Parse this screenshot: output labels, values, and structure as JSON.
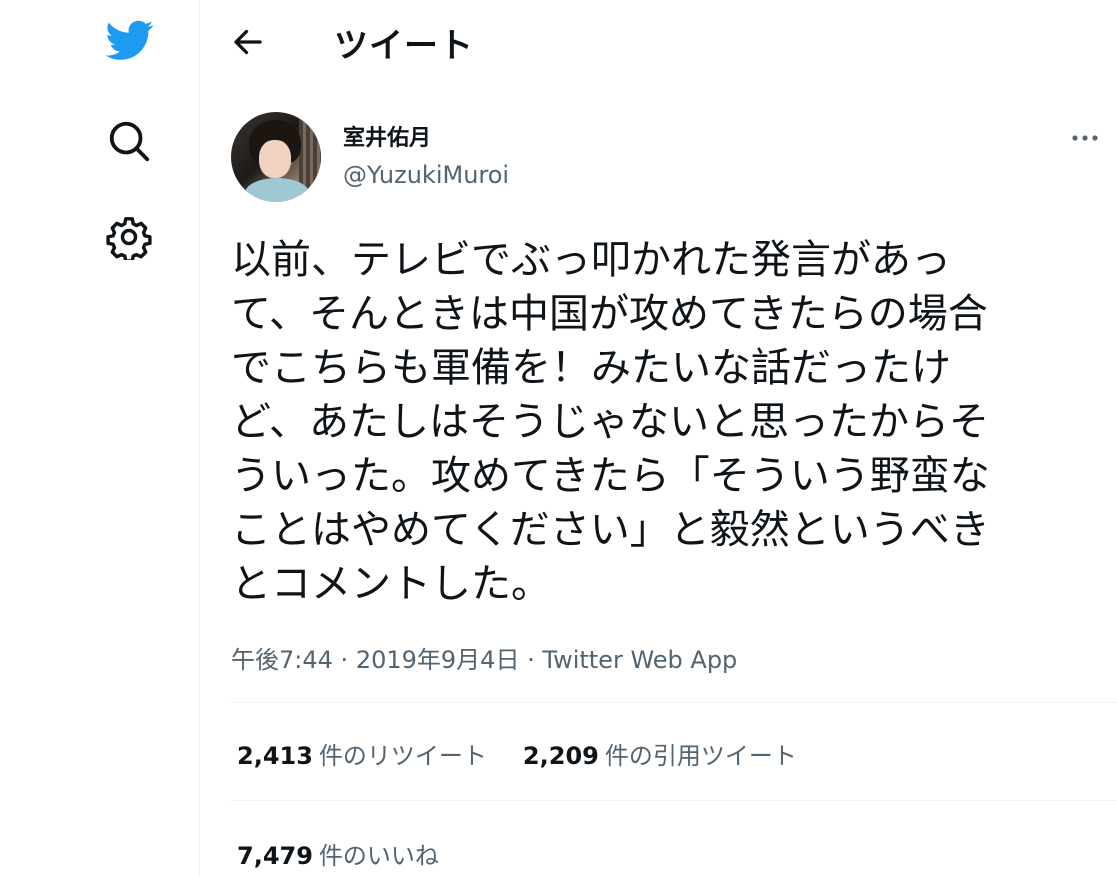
{
  "colors": {
    "accent": "#1d9bf0",
    "text": "#0f1419",
    "secondary": "#536471",
    "border": "#eff3f4"
  },
  "sidebar": {
    "icons": [
      "twitter-logo-icon",
      "search-icon",
      "settings-icon"
    ]
  },
  "header": {
    "title": "ツイート",
    "back_icon": "arrow-left-icon"
  },
  "tweet": {
    "display_name": "室井佑月",
    "handle": "@YuzukiMuroi",
    "lines": [
      "以前、テレビでぶっ叩かれた発言があっ",
      "て、そんときは中国が攻めてきたらの場合",
      "でこちらも軍備を！みたいな話だったけ",
      "ど、あたしはそうじゃないと思ったからそ",
      "ういった。攻めてきたら「そういう野蛮な",
      "ことはやめてください」と毅然というべき",
      "とコメントした。"
    ],
    "time": "午後7:44",
    "date": "2019年9月4日",
    "separator": "·",
    "source": "Twitter Web App"
  },
  "stats": {
    "retweets": {
      "count": "2,413",
      "label": "件のリツイート"
    },
    "quotes": {
      "count": "2,209",
      "label": "件の引用ツイート"
    },
    "likes": {
      "count": "7,479",
      "label": "件のいいね"
    }
  }
}
